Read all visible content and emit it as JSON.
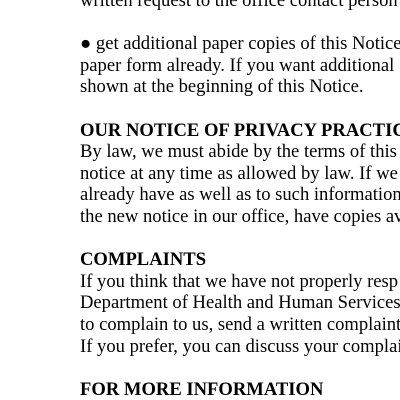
{
  "document": {
    "intro_fragment": {
      "lines": [
        "written request to the office contact person"
      ]
    },
    "bullet": {
      "glyph": "●",
      "lines": [
        "get additional paper copies of this Notice",
        "paper form already. If you want additional",
        "shown at the beginning of this Notice."
      ]
    },
    "privacy_section": {
      "heading": "OUR NOTICE OF PRIVACY PRACTICES",
      "lines": [
        "By law, we must abide by the terms of this",
        "notice at any time as allowed by law. If we",
        "already have as well as to such information",
        "the new notice in our office, have copies av"
      ]
    },
    "complaints_section": {
      "heading": "COMPLAINTS",
      "lines": [
        "If you think that we have not properly resp",
        "Department of Health and Human Services",
        "to complain to us, send a written complaint",
        "If you prefer, you can discuss your complai"
      ]
    },
    "more_info_section": {
      "heading": "FOR MORE INFORMATION"
    }
  }
}
